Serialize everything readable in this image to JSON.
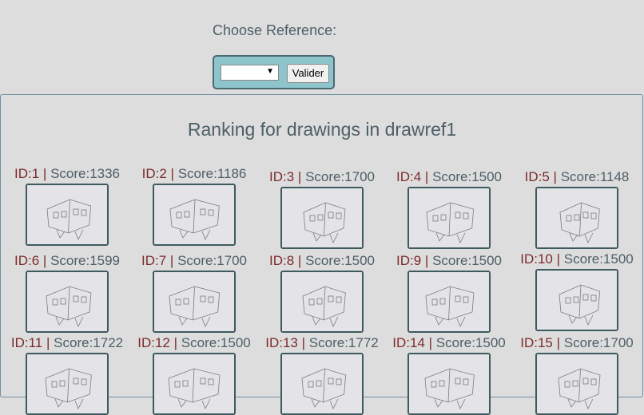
{
  "header": {
    "choose_label": "Choose Reference:",
    "select_value": "",
    "select_arrow": "▼",
    "valider_label": "Valider"
  },
  "ranking": {
    "title": "Ranking for drawings in drawref1",
    "separator": "|",
    "items": [
      {
        "id": "ID:1",
        "score": "Score:1336"
      },
      {
        "id": "ID:2",
        "score": "Score:1186"
      },
      {
        "id": "ID:3",
        "score": "Score:1700"
      },
      {
        "id": "ID:4",
        "score": "Score:1500"
      },
      {
        "id": "ID:5",
        "score": "Score:1148"
      },
      {
        "id": "ID:6",
        "score": "Score:1599"
      },
      {
        "id": "ID:7",
        "score": "Score:1700"
      },
      {
        "id": "ID:8",
        "score": "Score:1500"
      },
      {
        "id": "ID:9",
        "score": "Score:1500"
      },
      {
        "id": "ID:10",
        "score": "Score:1500"
      },
      {
        "id": "ID:11",
        "score": "Score:1722"
      },
      {
        "id": "ID:12",
        "score": "Score:1500"
      },
      {
        "id": "ID:13",
        "score": "Score:1772"
      },
      {
        "id": "ID:14",
        "score": "Score:1500"
      },
      {
        "id": "ID:15",
        "score": "Score:1700"
      }
    ]
  },
  "colors": {
    "background": "#dddddd",
    "accent_box": "#8ec4cc",
    "id_text": "#7d2a2a",
    "score_text": "#4d5f66"
  }
}
